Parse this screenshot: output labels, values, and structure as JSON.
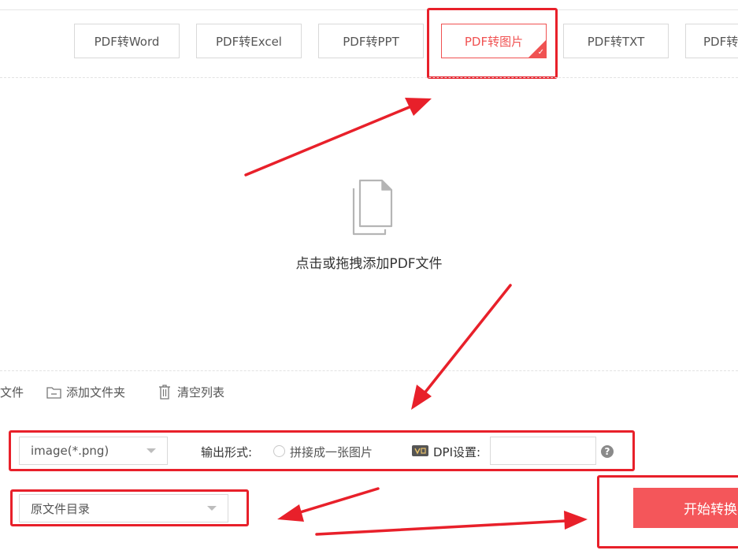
{
  "tabs": [
    {
      "label": "PDF转Word",
      "active": false
    },
    {
      "label": "PDF转Excel",
      "active": false
    },
    {
      "label": "PDF转PPT",
      "active": false
    },
    {
      "label": "PDF转图片",
      "active": true
    },
    {
      "label": "PDF转TXT",
      "active": false
    },
    {
      "label": "PDF转",
      "active": false
    }
  ],
  "dropzone": {
    "hint": "点击或拖拽添加PDF文件",
    "icon": "document-stack-icon"
  },
  "actions": {
    "add_file_partial": "文件",
    "add_folder": "添加文件夹",
    "clear_list": "清空列表"
  },
  "settings": {
    "format_value": "image(*.png)",
    "output_form_label": "输出形式:",
    "merge_option": "拼接成一张图片",
    "dpi_label": "DPI设置:",
    "dpi_value": "",
    "help": "?"
  },
  "output": {
    "dir_value": "原文件目录"
  },
  "start_button": "开始转换",
  "colors": {
    "accent": "#f05252",
    "annotation": "#e8202a",
    "button": "#f4565a"
  }
}
